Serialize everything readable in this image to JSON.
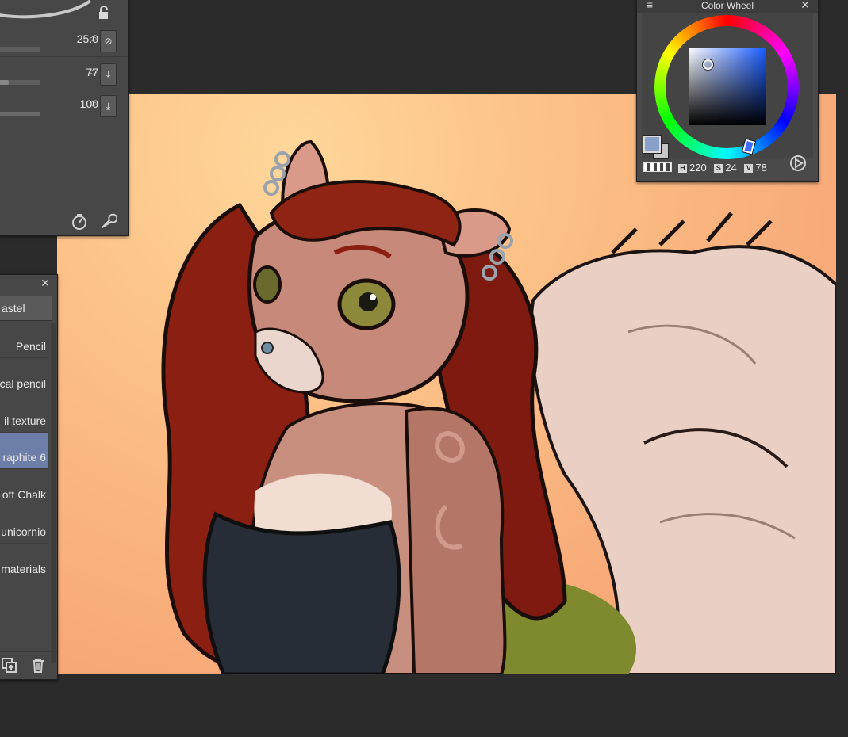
{
  "brush_panel": {
    "rows": [
      {
        "value": "25.0",
        "button_icon": "slash-circle-icon",
        "level": 0.6
      },
      {
        "value": "77",
        "button_icon": "download-icon",
        "level": 0.08
      },
      {
        "value": "100",
        "button_icon": "download-icon",
        "level": 1.0
      }
    ],
    "bottom_icons": [
      "dial-icon",
      "wrench-icon"
    ]
  },
  "sub_tool_panel": {
    "header": "astel",
    "items": [
      {
        "label": "Pencil",
        "selected": false
      },
      {
        "label": "cal pencil",
        "selected": false
      },
      {
        "label": "il texture",
        "selected": false
      },
      {
        "label": "raphite 6",
        "selected": true
      },
      {
        "label": "oft Chalk",
        "selected": false
      },
      {
        "label": "unicornio",
        "selected": false
      },
      {
        "label": "materials",
        "selected": false
      }
    ],
    "bottom_icons": [
      "duplicate-icon",
      "trash-icon"
    ]
  },
  "color_wheel": {
    "title": "Color Wheel",
    "h_tag": "H",
    "h": "220",
    "s_tag": "S",
    "s": "24",
    "v_tag": "V",
    "v": "78",
    "main_color": "#8aa0c8",
    "sub_color": "#c8c8c8"
  },
  "colors": {
    "app_bg": "#2b2b2b",
    "panel_bg": "#474747",
    "selection": "#6d7ea8"
  }
}
